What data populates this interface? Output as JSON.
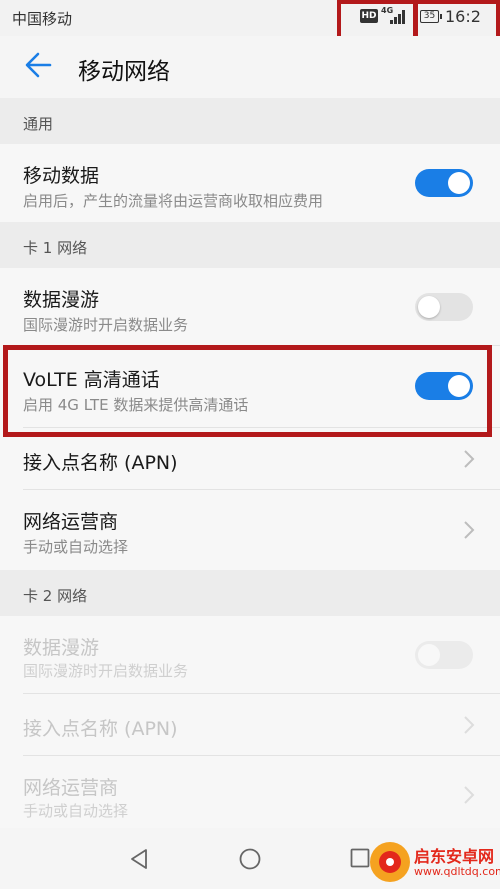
{
  "status_bar": {
    "carrier": "中国移动",
    "hd": "HD",
    "network": "4G",
    "battery": "35",
    "time": "16:2"
  },
  "app_bar": {
    "title": "移动网络"
  },
  "sections": {
    "general": "通用",
    "sim1": "卡 1 网络",
    "sim2": "卡 2 网络"
  },
  "mobile_data": {
    "title": "移动数据",
    "subtitle": "启用后，产生的流量将由运营商收取相应费用",
    "enabled": true
  },
  "sim1": {
    "roaming": {
      "title": "数据漫游",
      "subtitle": "国际漫游时开启数据业务",
      "enabled": false
    },
    "volte": {
      "title": "VoLTE 高清通话",
      "subtitle": "启用 4G LTE 数据来提供高清通话",
      "enabled": true
    },
    "apn": {
      "title": "接入点名称 (APN)"
    },
    "operator": {
      "title": "网络运营商",
      "subtitle": "手动或自动选择"
    }
  },
  "sim2": {
    "roaming": {
      "title": "数据漫游",
      "subtitle": "国际漫游时开启数据业务",
      "enabled": false,
      "disabled": true
    },
    "apn": {
      "title": "接入点名称 (APN)",
      "disabled": true
    },
    "operator": {
      "title": "网络运营商",
      "subtitle": "手动或自动选择",
      "disabled": true
    }
  },
  "watermark": {
    "title": "启东安卓网",
    "url": "www.qdltdq.com"
  },
  "colors": {
    "accent": "#1a7ee6",
    "highlight": "#b3191b",
    "watermark": "#e3281b"
  },
  "icons": [
    "back-arrow-icon",
    "chevron-right-icon",
    "signal-icon",
    "battery-icon",
    "nav-back-icon",
    "nav-home-icon",
    "nav-recent-icon"
  ]
}
